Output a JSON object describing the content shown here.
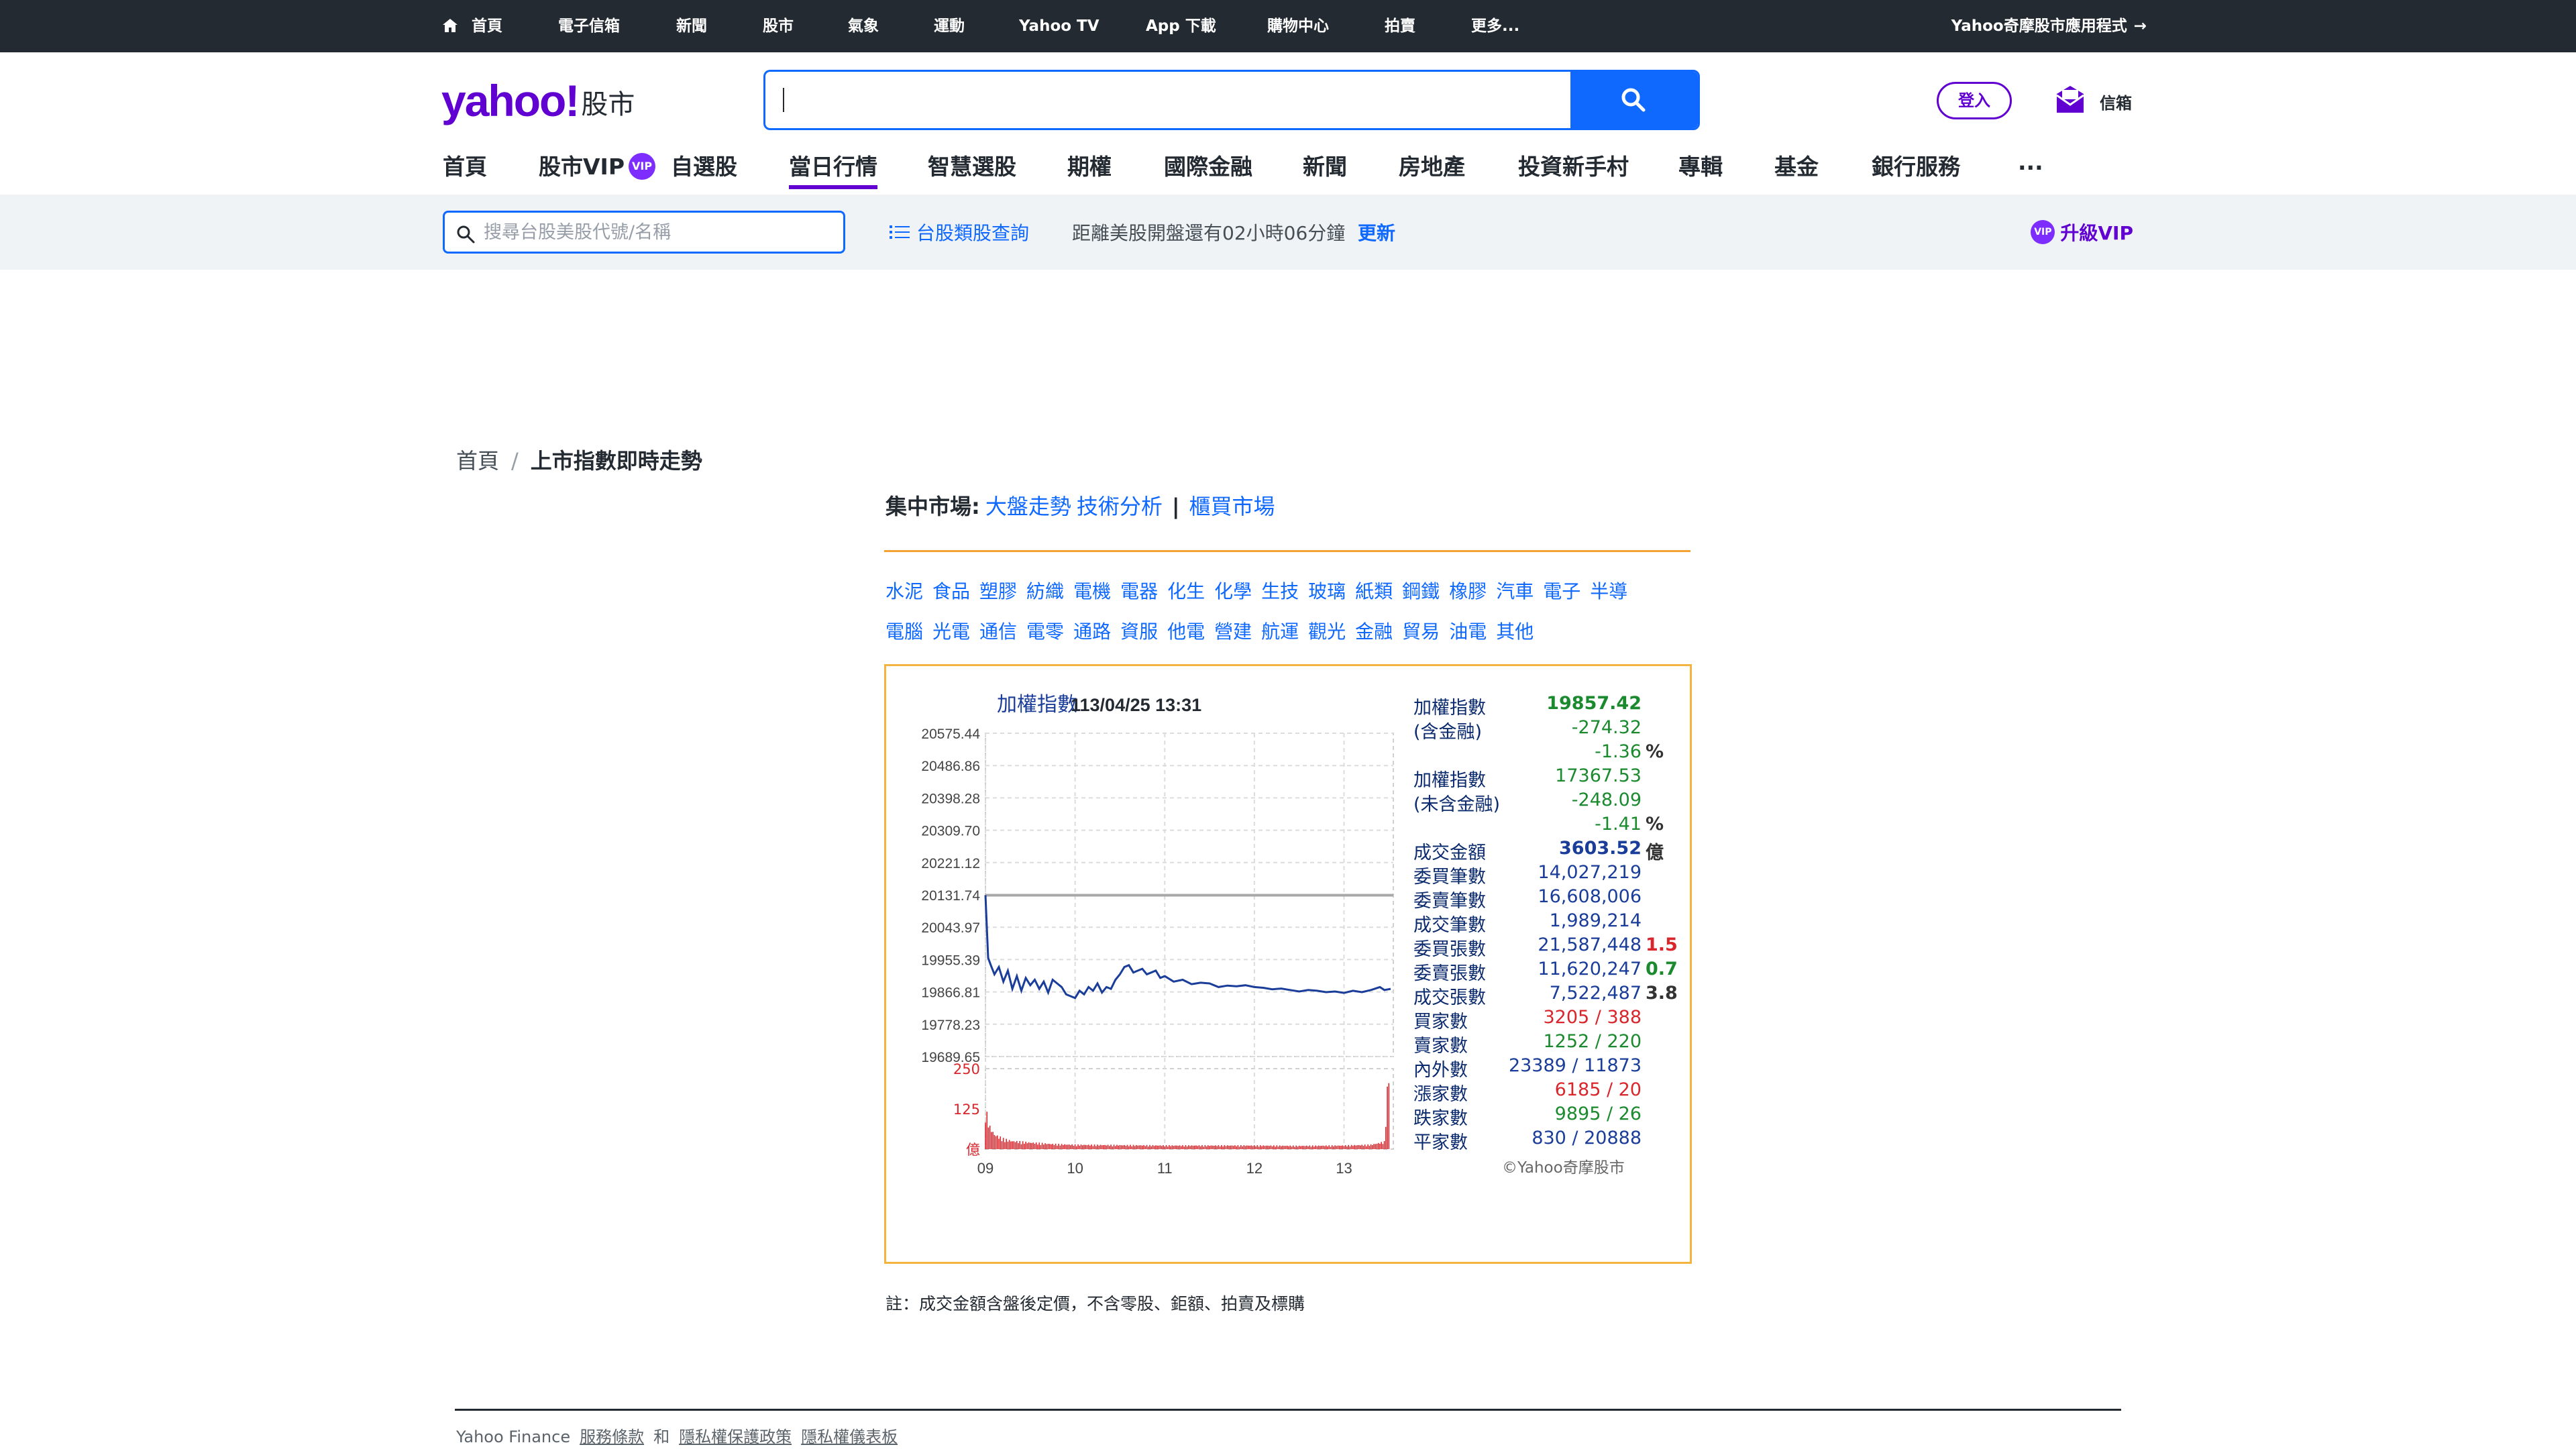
{
  "topbar": {
    "items": [
      "首頁",
      "電子信箱",
      "新聞",
      "股市",
      "氣象",
      "運動",
      "Yahoo TV",
      "App 下載",
      "購物中心",
      "拍賣",
      "更多..."
    ],
    "app_link": "Yahoo奇摩股市應用程式",
    "app_arrow": "→"
  },
  "header": {
    "logo_text": "yahoo!",
    "logo_sub": "股市",
    "search_value": "",
    "login_label": "登入",
    "mail_label": "信箱"
  },
  "mainnav": {
    "items": [
      "首頁",
      "股市VIP",
      "自選股",
      "當日行情",
      "智慧選股",
      "期權",
      "國際金融",
      "新聞",
      "房地產",
      "投資新手村",
      "專輯",
      "基金",
      "銀行服務",
      "..."
    ],
    "active": "當日行情",
    "vip_badge": "VIP"
  },
  "subbar": {
    "search_placeholder": "搜尋台股美股代號/名稱",
    "tw_class_label": "台股類股查詢",
    "countdown": "距離美股開盤還有02小時06分鐘",
    "refresh_label": "更新",
    "upgrade_label": "升級VIP",
    "upgrade_badge": "VIP"
  },
  "breadcrumb": {
    "home": "首頁",
    "sep": "/",
    "current": "上市指數即時走勢"
  },
  "market": {
    "label": "集中市場:",
    "links": [
      "大盤走勢",
      "技術分析"
    ],
    "bar": "|",
    "otc": "櫃買市場"
  },
  "industries": {
    "row1": [
      "水泥",
      "食品",
      "塑膠",
      "紡織",
      "電機",
      "電器",
      "化生",
      "化學",
      "生技",
      "玻璃",
      "紙類",
      "鋼鐵",
      "橡膠",
      "汽車",
      "電子",
      "半導"
    ],
    "row2": [
      "電腦",
      "光電",
      "通信",
      "電零",
      "通路",
      "資服",
      "他電",
      "營建",
      "航運",
      "觀光",
      "金融",
      "貿易",
      "油電",
      "其他"
    ]
  },
  "chart_data": {
    "type": "line",
    "title": "加權指數",
    "timestamp": "113/04/25 13:31",
    "yticks": [
      "20575.44",
      "20486.86",
      "20398.28",
      "20309.70",
      "20221.12",
      "20131.74",
      "20043.97",
      "19955.39",
      "19866.81",
      "19778.23",
      "19689.65"
    ],
    "ylim": [
      19689.65,
      20575.44
    ],
    "reference_level": 20131.74,
    "xticks": [
      "09",
      "10",
      "11",
      "12",
      "13"
    ],
    "volume_yticks": [
      "250",
      "125",
      "億"
    ],
    "volume_ylim": [
      0,
      250
    ],
    "series": [
      {
        "x": [
          9.0,
          9.03,
          9.06,
          9.1,
          9.15,
          9.2,
          9.25,
          9.3,
          9.35,
          9.4,
          9.45,
          9.5,
          9.55,
          9.6,
          9.65,
          9.7,
          9.75,
          9.8,
          9.85,
          9.9,
          9.95,
          10.0,
          10.05,
          10.1,
          10.15,
          10.2,
          10.25,
          10.3,
          10.35,
          10.4,
          10.45,
          10.5,
          10.55,
          10.6,
          10.65,
          10.7,
          10.75,
          10.8,
          10.85,
          10.9,
          10.95,
          11.0,
          11.1,
          11.2,
          11.3,
          11.4,
          11.5,
          11.6,
          11.7,
          11.8,
          11.9,
          12.0,
          12.1,
          12.2,
          12.3,
          12.4,
          12.5,
          12.6,
          12.7,
          12.8,
          12.9,
          13.0,
          13.1,
          13.2,
          13.3,
          13.4,
          13.45,
          13.52
        ],
        "y": [
          20131.74,
          19960,
          19940,
          19915,
          19935,
          19895,
          19925,
          19875,
          19910,
          19870,
          19905,
          19885,
          19900,
          19875,
          19895,
          19865,
          19900,
          19890,
          19880,
          19860,
          19855,
          19850,
          19870,
          19860,
          19880,
          19870,
          19890,
          19865,
          19880,
          19875,
          19900,
          19915,
          19935,
          19940,
          19920,
          19925,
          19930,
          19915,
          19920,
          19925,
          19905,
          19910,
          19895,
          19900,
          19888,
          19892,
          19890,
          19880,
          19884,
          19882,
          19885,
          19880,
          19878,
          19874,
          19876,
          19872,
          19868,
          19872,
          19870,
          19866,
          19868,
          19864,
          19870,
          19866,
          19872,
          19880,
          19872,
          19875
        ]
      }
    ],
    "volume_series": {
      "note": "",
      "x": [
        9.0,
        9.05,
        9.1,
        9.2,
        9.3,
        9.5,
        9.75,
        10.0,
        10.5,
        11.0,
        11.5,
        12.0,
        12.5,
        13.0,
        13.3,
        13.45,
        13.5
      ],
      "y": [
        110,
        60,
        40,
        28,
        22,
        18,
        14,
        12,
        11,
        10,
        10,
        10,
        9,
        10,
        12,
        20,
        225
      ]
    }
  },
  "stats": [
    {
      "k": "加權指數",
      "v": "19857.42",
      "k_color": "navy",
      "v_color": "green",
      "bold": true
    },
    {
      "k": "(含金融)",
      "v": "-274.32",
      "k_color": "navy",
      "v_color": "green"
    },
    {
      "k": "",
      "v": "-1.36",
      "x": "%",
      "v_color": "green"
    },
    {
      "k": "加權指數",
      "v": "17367.53",
      "k_color": "brown",
      "v_color": "green"
    },
    {
      "k": "(未含金融)",
      "v": "-248.09",
      "k_color": "brown",
      "v_color": "green"
    },
    {
      "k": "",
      "v": "-1.41",
      "x": "%",
      "v_color": "green"
    },
    {
      "k": "成交金額",
      "v": "3603.52",
      "x": "億",
      "v_color": "blue",
      "bold": true
    },
    {
      "k": "委買筆數",
      "v": "14,027,219",
      "v_color": "blue"
    },
    {
      "k": "委賣筆數",
      "v": "16,608,006",
      "v_color": "blue"
    },
    {
      "k": "成交筆數",
      "v": "1,989,214",
      "v_color": "blue"
    },
    {
      "k": "委買張數",
      "v": "21,587,448",
      "x": "1.5",
      "v_color": "blue",
      "x_color": "red"
    },
    {
      "k": "委賣張數",
      "v": "11,620,247",
      "x": "0.7",
      "v_color": "blue",
      "x_color": "green"
    },
    {
      "k": "成交張數",
      "v": "7,522,487",
      "x": "3.8",
      "v_color": "blue",
      "x_color": "dark"
    },
    {
      "k": "買家數",
      "v": "3205 / 388",
      "v_color": "red"
    },
    {
      "k": "賣家數",
      "v": "1252 / 220",
      "v_color": "green"
    },
    {
      "k": "內外數",
      "v": "23389 / 11873",
      "v_color": "blue"
    },
    {
      "k": "漲家數",
      "v": "6185 / 20",
      "v_color": "red"
    },
    {
      "k": "跌家數",
      "v": "9895 / 26",
      "v_color": "green"
    },
    {
      "k": "平家數",
      "v": "830 / 20888",
      "v_color": "blue"
    }
  ],
  "copyright": "©Yahoo奇摩股市",
  "note": "註：成交金額含盤後定價，不含零股、鉅額、拍賣及標購",
  "footer": {
    "brand": "Yahoo Finance",
    "links": [
      "服務條款",
      "隱私權保護政策",
      "隱私權儀表板"
    ],
    "and": "和"
  },
  "colors": {
    "brand_purple": "#6001d2",
    "accent_blue": "#0f69ff",
    "topbar_bg": "#232a31",
    "chart_border": "#f3b53f",
    "line_blue": "#1a3d9a",
    "volume_red": "#d9262c",
    "reference_gray": "#999999"
  }
}
